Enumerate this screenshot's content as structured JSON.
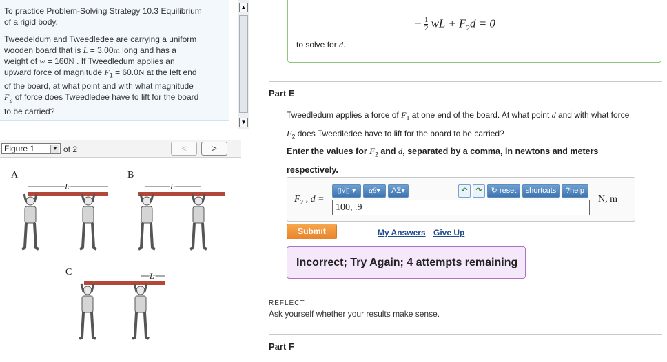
{
  "intro": {
    "line1": "To practice Problem-Solving Strategy 10.3 Equilibrium",
    "line2": "of a rigid body.",
    "problem_lines": [
      "Tweedeldum and Tweedledee are carrying a uniform",
      "wooden board that is ",
      "weight of ",
      "upward force of magnitude ",
      "of the board, at what point and with what magnitude",
      "of force does Tweedledee have to lift for the board",
      "to be carried?"
    ],
    "L_symbol": "L",
    "L_value": " = 3.00",
    "L_unit": "m",
    "L_after": " long and has a",
    "w_symbol": "w",
    "w_value": " = 160",
    "w_unit": "N",
    "w_after": " . If Tweedledum applies an",
    "F1_symbol": "F",
    "F1_sub": "1",
    "F1_value": " = 60.0",
    "F1_unit": "N",
    "F1_after": " at the left end",
    "F2_symbol": "F",
    "F2_sub": "2"
  },
  "figure_nav": {
    "selected": "Figure 1",
    "of_label": "of 2",
    "prev_icon": "<",
    "next_icon": ">"
  },
  "figure": {
    "label_a": "A",
    "label_b": "B",
    "label_c": "C",
    "dimension": "L"
  },
  "top_box": {
    "equation_neg": "−",
    "frac_num": "1",
    "frac_den": "2",
    "equation_rest": "wL + F",
    "equation_sub": "2",
    "equation_tail": "d = 0",
    "solve_prefix": "to solve for ",
    "solve_var": "d",
    "solve_suffix": "."
  },
  "part_e": {
    "title": "Part E",
    "desc_a": "Tweedledum applies a force of ",
    "desc_f": "F",
    "desc_sub1": "1",
    "desc_b": " at one end of the board. At what point ",
    "desc_d": "d",
    "desc_c": " and with what force",
    "desc2_sub": "2",
    "desc2_rest": " does Tweedledee have to lift for the board to be carried?",
    "instruction1": "Enter the values for ",
    "instruction_F2": "F",
    "instruction_sub": "2",
    "instruction_mid": " and ",
    "instruction_d": "d",
    "instruction_end": ", separated by a comma, in newtons and meters",
    "instruction2": "respectively."
  },
  "answer": {
    "label_F": "F",
    "label_sub": "2",
    "label_rest": " , d =",
    "value": "100, .9",
    "units": "N, m",
    "toolbar": {
      "templates": "▯√▯",
      "greek": "αβ",
      "symbols": "ΑΣ",
      "reset": "reset",
      "shortcuts": "shortcuts",
      "help": "help"
    }
  },
  "actions": {
    "submit": "Submit",
    "my_answers": "My Answers",
    "give_up": "Give Up"
  },
  "feedback": "Incorrect; Try Again; 4 attempts remaining",
  "reflect": {
    "title": "REFLECT",
    "text": "Ask yourself whether your results make sense."
  },
  "part_f": {
    "title": "Part F"
  },
  "colors": {
    "accent_green": "#8fc67a",
    "submit_orange": "#ef9a3f",
    "feedback_purple": "#b06fc6",
    "link_blue": "#1f4c8f",
    "board_red": "#b3473a"
  }
}
